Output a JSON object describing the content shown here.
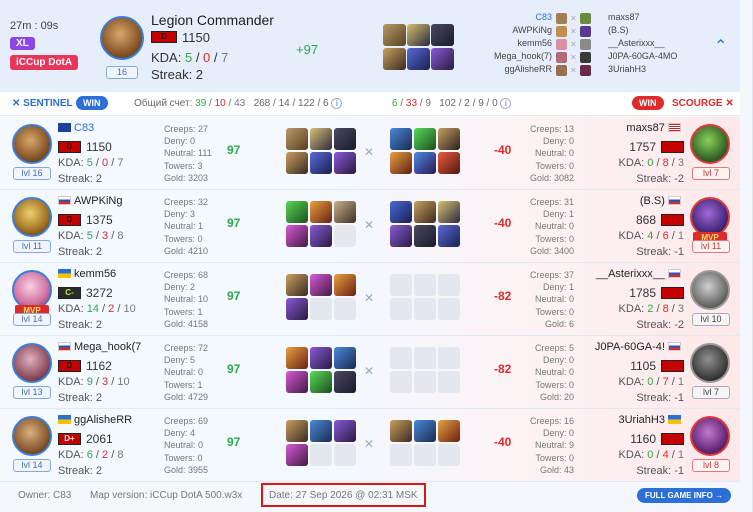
{
  "match": {
    "duration": "27m : 09s",
    "size_tag": "XL",
    "league_tag": "iCCup DotA",
    "hero": "Legion Commander",
    "rank_badge": "D",
    "rating": "1150",
    "kda": {
      "k": "5",
      "d": "0",
      "a": "7"
    },
    "kda_label": "KDA:",
    "streak": "Streak: 2",
    "level": "16",
    "delta": "+97"
  },
  "lineup": [
    {
      "left": "C83",
      "right": "maxs87"
    },
    {
      "left": "AWPKiNg",
      "right": "(B.S)"
    },
    {
      "left": "kemm56",
      "right": "__Asterixxx__"
    },
    {
      "left": "Mega_hook(7)",
      "right": "J0PA-60GA-4MO"
    },
    {
      "left": "ggAlisheRR",
      "right": "3UriahH3"
    }
  ],
  "scorebar": {
    "sentinel": "SENTINEL",
    "scourge": "SCOURGE",
    "win": "WIN",
    "total_label": "Общий счет:",
    "left": {
      "k": "39",
      "d": "10",
      "a": "43",
      "rest": "268 / 14 / 122 / 6"
    },
    "right": {
      "k": "6",
      "d": "33",
      "a": "9",
      "rest": "102 / 2 / 9 / 0"
    },
    "info": "i"
  },
  "rows": [
    {
      "left": {
        "name": "C83",
        "rank": "D",
        "rating": "1150",
        "k": "5",
        "d": "0",
        "a": "7",
        "streak": "Streak: 2",
        "level": "lvl 16",
        "stats": [
          "Creeps: 27",
          "Deny: 0",
          "Neutral: 111",
          "Towers: 3",
          "Gold: 3203"
        ],
        "delta": "97"
      },
      "right": {
        "name": "maxs87",
        "rating": "1757",
        "k": "0",
        "d": "8",
        "a": "3",
        "streak": "Streak: -2",
        "level": "lvl 7",
        "stats": [
          "Creeps: 13",
          "Deny: 0",
          "Neutral: 0",
          "Towers: 0",
          "Gold: 3082"
        ],
        "delta": "-40"
      }
    },
    {
      "left": {
        "name": "AWPKiNg",
        "rank": "D",
        "rating": "1375",
        "k": "5",
        "d": "3",
        "a": "8",
        "streak": "Streak: 2",
        "level": "lvl 11",
        "stats": [
          "Creeps: 32",
          "Deny: 3",
          "Neutral: 1",
          "Towers: 0",
          "Gold: 4210"
        ],
        "delta": "97"
      },
      "right": {
        "name": "(B.S)",
        "rating": "868",
        "k": "4",
        "d": "6",
        "a": "1",
        "streak": "Streak: -1",
        "level": "lvl 11",
        "mvp": "MVP",
        "stats": [
          "Creeps: 31",
          "Deny: 1",
          "Neutral: 0",
          "Towers: 0",
          "Gold: 3400"
        ],
        "delta": "-40"
      }
    },
    {
      "left": {
        "name": "kemm56",
        "rank": "C-",
        "rating": "3272",
        "k": "14",
        "d": "2",
        "a": "10",
        "streak": "Streak: 2",
        "level": "lvl 14",
        "mvp": "MVP",
        "stats": [
          "Creeps: 68",
          "Deny: 2",
          "Neutral: 10",
          "Towers: 1",
          "Gold: 4158"
        ],
        "delta": "97"
      },
      "right": {
        "name": "__Asterixxx__",
        "rating": "1785",
        "k": "2",
        "d": "8",
        "a": "3",
        "streak": "Streak: -2",
        "level": "lvl 10",
        "stats": [
          "Creeps: 37",
          "Deny: 1",
          "Neutral: 0",
          "Towers: 0",
          "Gold: 6"
        ],
        "delta": "-82"
      }
    },
    {
      "left": {
        "name": "Mega_hook(7",
        "rank": "D",
        "rating": "1162",
        "k": "9",
        "d": "3",
        "a": "10",
        "streak": "Streak: 2",
        "level": "lvl 13",
        "stats": [
          "Creeps: 72",
          "Deny: 5",
          "Neutral: 0",
          "Towers: 1",
          "Gold: 4729"
        ],
        "delta": "97"
      },
      "right": {
        "name": "J0PA-60GA-4!",
        "rating": "1105",
        "k": "0",
        "d": "7",
        "a": "1",
        "streak": "Streak: -1",
        "level": "lvl 7",
        "stats": [
          "Creeps: 5",
          "Deny: 0",
          "Neutral: 0",
          "Towers: 0",
          "Gold: 20"
        ],
        "delta": "-82"
      }
    },
    {
      "left": {
        "name": "ggAlisheRR",
        "rank": "D+",
        "rating": "2061",
        "k": "6",
        "d": "2",
        "a": "8",
        "streak": "Streak: 2",
        "level": "lvl 14",
        "stats": [
          "Creeps: 69",
          "Deny: 4",
          "Neutral: 0",
          "Towers: 0",
          "Gold: 3955"
        ],
        "delta": "97"
      },
      "right": {
        "name": "3UriahH3",
        "rating": "1160",
        "k": "0",
        "d": "4",
        "a": "1",
        "streak": "Streak: -1",
        "level": "lvl 8",
        "stats": [
          "Creeps: 16",
          "Deny: 0",
          "Neutral: 9",
          "Towers: 0",
          "Gold: 43"
        ],
        "delta": "-40"
      }
    }
  ],
  "footer": {
    "owner": "Owner: C83",
    "map": "Map version: iCCup DotA 500.w3x",
    "date": "Date: 27 Sep 2026 @ 02:31 MSK",
    "button": "FULL GAME INFO →"
  },
  "colors": {
    "accent": "#2c6fd6",
    "win_red": "#e02a2a",
    "positive": "#2fa84a",
    "highlight_box": "#d81818"
  }
}
